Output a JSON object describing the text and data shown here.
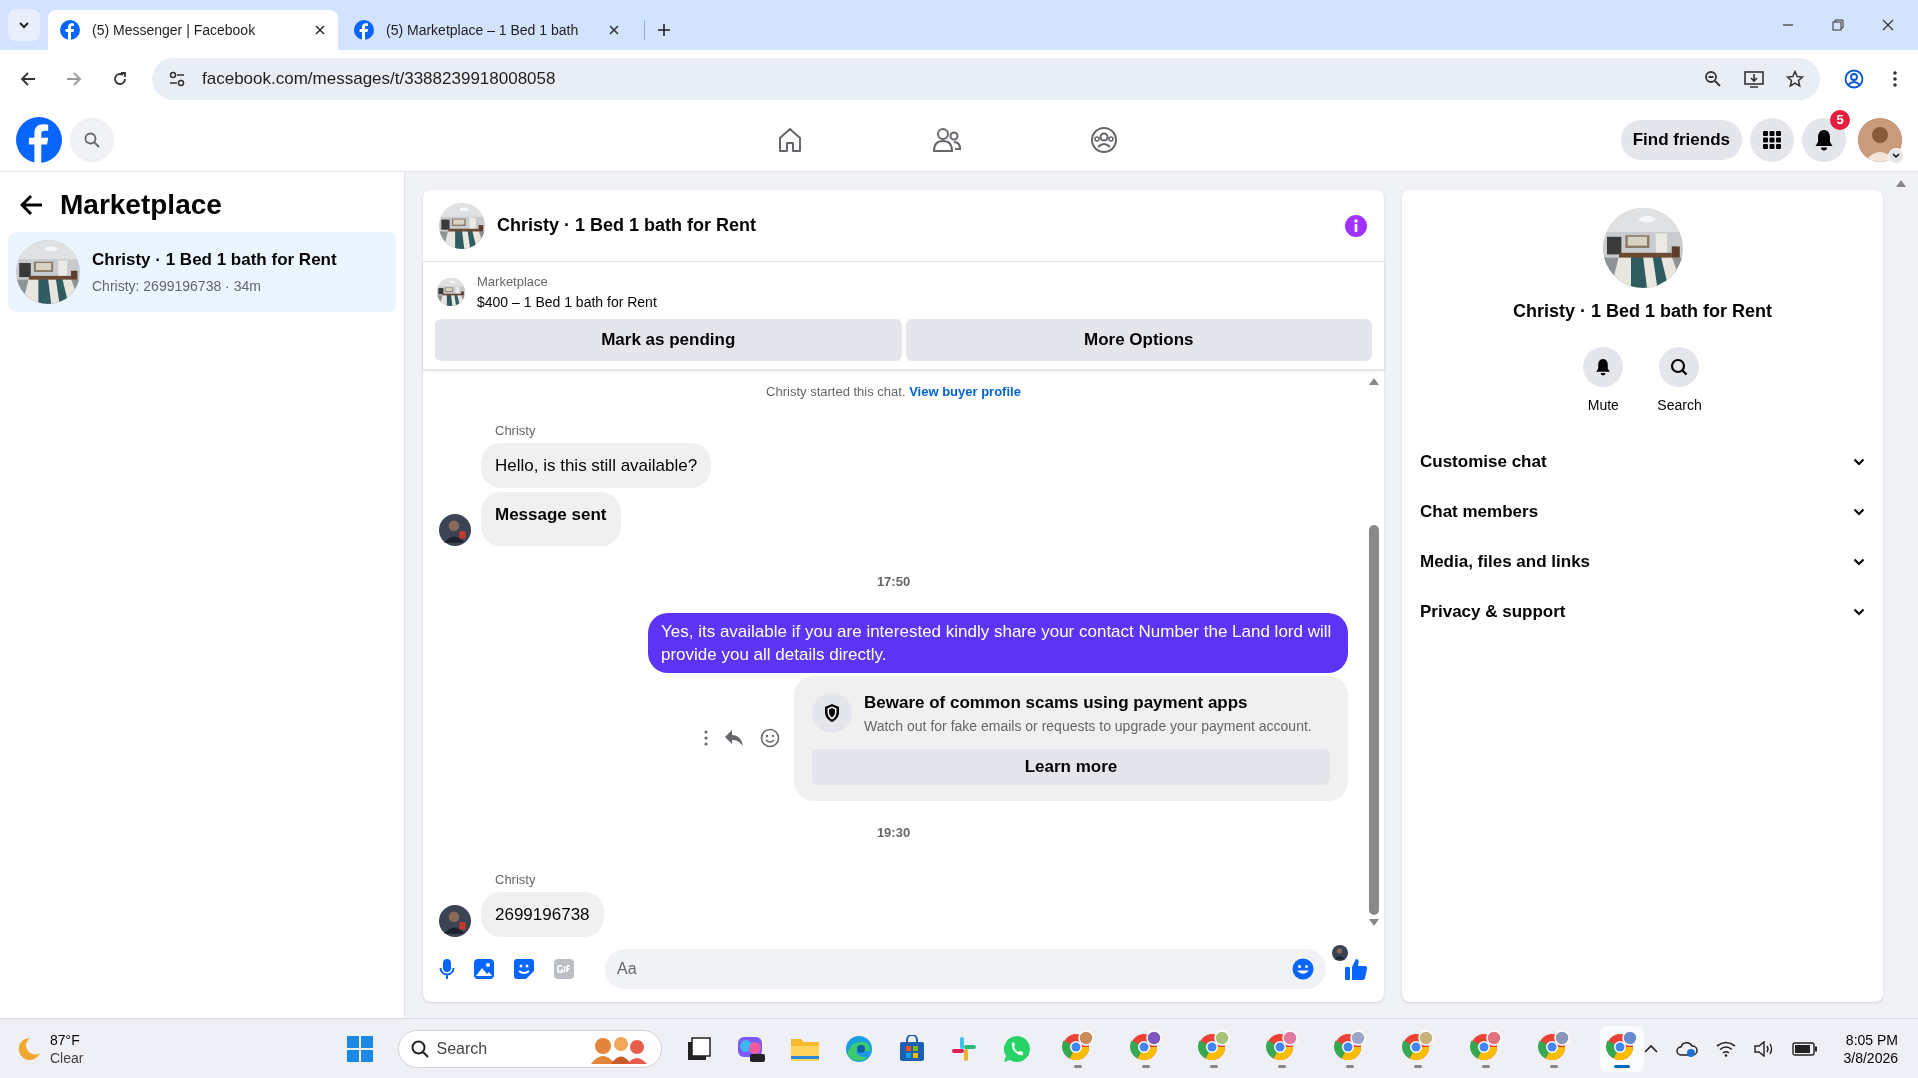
{
  "browser": {
    "tabs": [
      {
        "title": "(5) Messenger | Facebook",
        "selected": true
      },
      {
        "title": "(5) Marketplace – 1 Bed 1 bath",
        "selected": false
      }
    ],
    "address": "facebook.com/messages/t/3388239918008058"
  },
  "header": {
    "find_friends": "Find friends",
    "notification_count": "5"
  },
  "sidebar": {
    "title": "Marketplace",
    "conversations": [
      {
        "title": "Christy · 1 Bed 1 bath for Rent",
        "preview": "Christy: 2699196738 · 34m",
        "selected": true
      }
    ]
  },
  "chat": {
    "title": "Christy · 1 Bed 1 bath for Rent",
    "listing": {
      "label": "Marketplace",
      "title": "$400 – 1 Bed 1 bath for Rent"
    },
    "buttons": [
      "Mark as pending",
      "More Options"
    ],
    "notice": {
      "text": "Christy started this chat.",
      "link": "View buyer profile"
    },
    "messages": [
      {
        "kind": "sender",
        "text": "Christy"
      },
      {
        "kind": "incoming",
        "text": "Hello, is this still available?",
        "bold": false,
        "avatar": false
      },
      {
        "kind": "incoming",
        "text": "Message sent",
        "bold": true,
        "avatar": true
      },
      {
        "kind": "time",
        "text": "17:50"
      },
      {
        "kind": "outgoing",
        "text": "Yes, its available if you are interested kindly share your contact Number the Land lord will provide you all details directly."
      },
      {
        "kind": "safety",
        "title": "Beware of common scams using payment apps",
        "text": "Watch out for fake emails or requests to upgrade your payment account.",
        "button": "Learn more"
      },
      {
        "kind": "time",
        "text": "19:30"
      },
      {
        "kind": "sender",
        "text": "Christy"
      },
      {
        "kind": "incoming",
        "text": "2699196738",
        "bold": false,
        "avatar": true
      }
    ],
    "composer": {
      "placeholder": "Aa"
    }
  },
  "details": {
    "title": "Christy · 1 Bed 1 bath for Rent",
    "actions": [
      {
        "kind": "mute",
        "label": "Mute"
      },
      {
        "kind": "search",
        "label": "Search"
      }
    ],
    "sections": [
      {
        "label": "Customise chat",
        "expanded": false
      },
      {
        "label": "Chat members",
        "expanded": false
      },
      {
        "label": "Media, files and links",
        "expanded": false
      },
      {
        "label": "Privacy & support",
        "expanded": false
      }
    ]
  },
  "taskbar": {
    "weather": {
      "temperature": "87°F",
      "condition": "Clear"
    },
    "search_placeholder": "Search",
    "time": "8:05 PM",
    "date": "3/8/2026"
  }
}
